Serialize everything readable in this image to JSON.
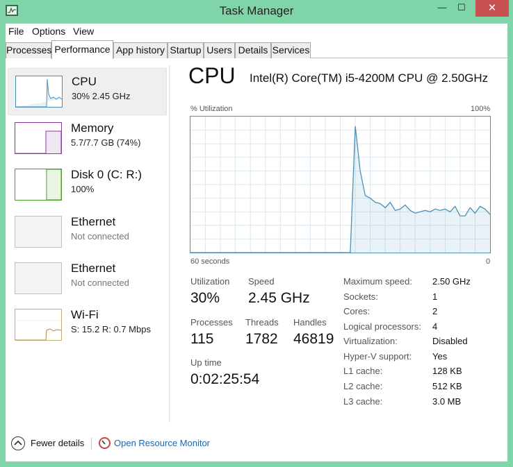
{
  "window": {
    "title": "Task Manager",
    "minimize_glyph": "—",
    "maximize_glyph": "☐",
    "close_glyph": "✕"
  },
  "menu": [
    "File",
    "Options",
    "View"
  ],
  "tabs": [
    "Processes",
    "Performance",
    "App history",
    "Startup",
    "Users",
    "Details",
    "Services"
  ],
  "active_tab": "Performance",
  "sidebar": {
    "items": [
      {
        "name": "CPU",
        "sub": "30%  2.45 GHz",
        "color": "#4a90b8",
        "selected": true
      },
      {
        "name": "Memory",
        "sub": "5.7/7.7 GB (74%)",
        "color": "#8b3a9e"
      },
      {
        "name": "Disk 0 (C: R:)",
        "sub": "100%",
        "color": "#4d9a2c"
      },
      {
        "name": "Ethernet",
        "sub": "Not connected",
        "color": "#bfbfbf"
      },
      {
        "name": "Ethernet",
        "sub": "Not connected",
        "color": "#bfbfbf"
      },
      {
        "name": "Wi-Fi",
        "sub_s_label": "S:",
        "sub_s": "15.2",
        "sub_r_label": "R:",
        "sub_r": "0.7 Mbps",
        "color": "#a88a3e"
      }
    ]
  },
  "main": {
    "title": "CPU",
    "model": "Intel(R) Core(TM) i5-4200M CPU @ 2.50GHz",
    "y_label": "% Utilization",
    "y_max_label": "100%",
    "x_left_label": "60 seconds",
    "x_right_label": "0",
    "stats": {
      "utilization_label": "Utilization",
      "utilization": "30%",
      "speed_label": "Speed",
      "speed": "2.45 GHz",
      "processes_label": "Processes",
      "processes": "115",
      "threads_label": "Threads",
      "threads": "1782",
      "handles_label": "Handles",
      "handles": "46819",
      "uptime_label": "Up time",
      "uptime": "0:02:25:54"
    },
    "specs": [
      {
        "label": "Maximum speed:",
        "value": "2.50 GHz"
      },
      {
        "label": "Sockets:",
        "value": "1"
      },
      {
        "label": "Cores:",
        "value": "2"
      },
      {
        "label": "Logical processors:",
        "value": "4"
      },
      {
        "label": "Virtualization:",
        "value": "Disabled"
      },
      {
        "label": "Hyper-V support:",
        "value": "Yes"
      },
      {
        "label": "L1 cache:",
        "value": "128 KB"
      },
      {
        "label": "L2 cache:",
        "value": "512 KB"
      },
      {
        "label": "L3 cache:",
        "value": "3.0 MB"
      }
    ]
  },
  "cpu_history": {
    "units": "percent",
    "note_x": "seconds ago, 60 to 0",
    "x": [
      60,
      28,
      27,
      26,
      25,
      24,
      23,
      22,
      21,
      20,
      19,
      18,
      17,
      16,
      15,
      14,
      13,
      12,
      11,
      10,
      9,
      8,
      7,
      6,
      5,
      4,
      3,
      2,
      1,
      0
    ],
    "y": [
      0,
      0,
      93,
      60,
      42,
      40,
      37,
      36,
      33,
      37,
      31,
      32,
      35,
      31,
      29,
      30,
      31,
      30,
      32,
      31,
      32,
      30,
      34,
      27,
      27,
      33,
      29,
      34,
      32,
      28
    ]
  },
  "footer": {
    "fewer_details": "Fewer details",
    "resource_monitor": "Open Resource Monitor"
  }
}
